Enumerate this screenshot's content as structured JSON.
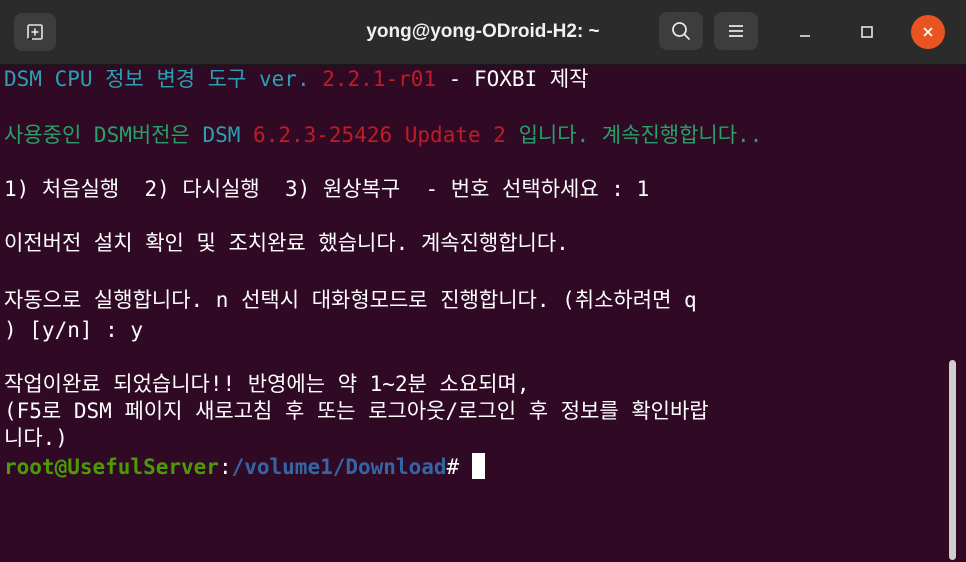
{
  "titlebar": {
    "title": "yong@yong-ODroid-H2: ~",
    "new_tab_icon": "new-tab-icon",
    "search_icon": "search-icon",
    "menu_icon": "hamburger-menu-icon",
    "minimize_icon": "minimize-icon",
    "maximize_icon": "maximize-icon",
    "close_icon": "close-icon",
    "close_color": "#e95420"
  },
  "terminal": {
    "lines": {
      "l1": {
        "a": "DSM CPU ",
        "b": "정보 변경 도구",
        "c": " ver. ",
        "d": "2.2.1-r01",
        "e": " - FOXBI 제작"
      },
      "l2": {
        "a": "사용중인 DSM버전은 ",
        "b": "DSM ",
        "c": "6.2.3-25426 Update 2",
        "d": " 입니다. 계속진행합니다.."
      },
      "l3": "1) 처음실행  2) 다시실행  3) 원상복구  - 번호 선택하세요 : 1",
      "l4": "이전버전 설치 확인 및 조치완료 했습니다. 계속진행합니다.",
      "l5": "자동으로 실행합니다. n 선택시 대화형모드로 진행합니다. (취소하려면 q",
      "l6": ") [y/n] : y",
      "l7": "작업이완료 되었습니다!! 반영에는 약 1~2분 소요되며,",
      "l8": "(F5로 DSM 페이지 새로고침 후 또는 로그아웃/로그인 후 정보를 확인바랍",
      "l9": "니다.)",
      "prompt": {
        "user": "root@UsefulServer",
        "sep": ":",
        "path": "/volume1/Download",
        "symbol": "# "
      }
    },
    "colors": {
      "background": "#300a24",
      "cyan": "#2aa1b3",
      "red": "#c01c28",
      "green": "#26a269",
      "prompt_user": "#4e9a06",
      "path": "#3465a4"
    }
  }
}
